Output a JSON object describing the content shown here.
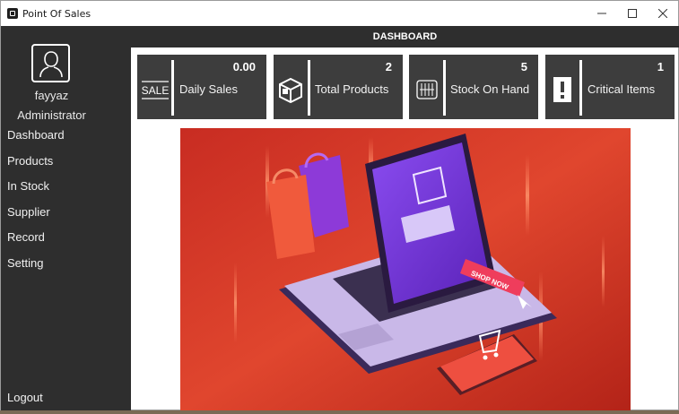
{
  "window": {
    "title": "Point Of Sales"
  },
  "header": {
    "title": "DASHBOARD"
  },
  "user": {
    "name": "fayyaz",
    "role": "Administrator"
  },
  "nav": {
    "items": [
      {
        "label": "Dashboard"
      },
      {
        "label": "Products"
      },
      {
        "label": "In Stock"
      },
      {
        "label": "Supplier"
      },
      {
        "label": "Record"
      },
      {
        "label": "Setting"
      }
    ],
    "logout": "Logout"
  },
  "cards": [
    {
      "label": "Daily Sales",
      "value": "0.00",
      "icon": "sale-tag-icon",
      "icon_text": "SALE"
    },
    {
      "label": "Total Products",
      "value": "2",
      "icon": "box-icon"
    },
    {
      "label": "Stock On Hand",
      "value": "5",
      "icon": "stock-icon"
    },
    {
      "label": "Critical Items",
      "value": "1",
      "icon": "alert-icon"
    }
  ],
  "banner": {
    "badge_text": "SHOP NOW"
  },
  "colors": {
    "sidebar": "#2e2e2e",
    "card": "#3d3d3d",
    "banner_red": "#d63a2a",
    "accent_purple": "#7b3fe0"
  }
}
